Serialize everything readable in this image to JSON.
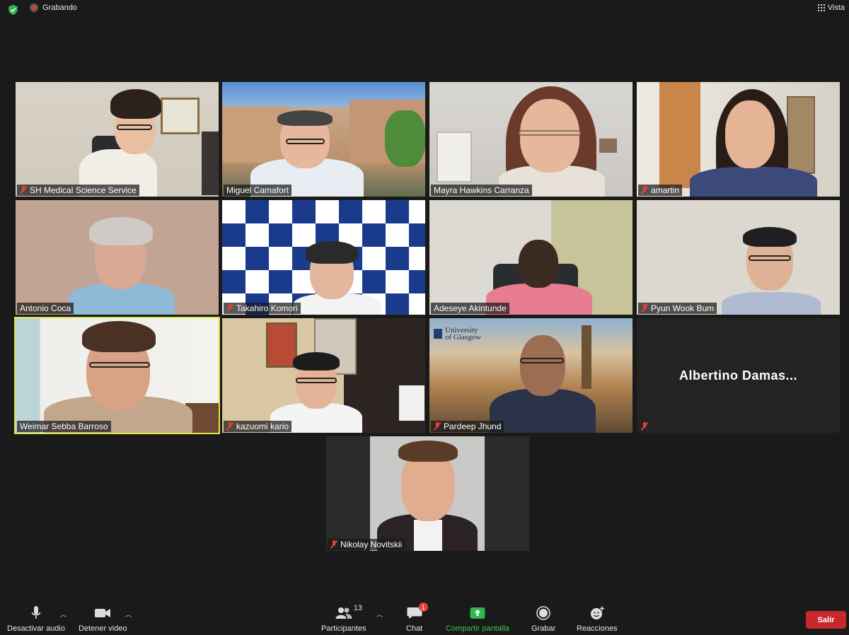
{
  "topbar": {
    "recording_label": "Grabando",
    "view_label": "Vista",
    "icons": [
      "shield-check-icon",
      "record-icon",
      "grid-view-icon"
    ]
  },
  "participants": [
    {
      "name": "SH Medical Science Service",
      "muted": true
    },
    {
      "name": "Miguel Camafort",
      "muted": false
    },
    {
      "name": "Mayra Hawkins Carranza",
      "muted": false
    },
    {
      "name": "amartin",
      "muted": true
    },
    {
      "name": "Antonio Coca",
      "muted": false
    },
    {
      "name": "Takahiro Komori",
      "muted": true
    },
    {
      "name": "Adeseye Akintunde",
      "muted": false
    },
    {
      "name": "Pyun Wook Bum",
      "muted": true
    },
    {
      "name": "Weimar Sebba Barroso",
      "muted": false,
      "active_speaker": true
    },
    {
      "name": "kazuomi kario",
      "muted": true
    },
    {
      "name": "Pardeep Jhund",
      "muted": true
    },
    {
      "name": "Albertino Damas...",
      "muted": true,
      "video_off": true
    },
    {
      "name": "Nikolay Novitskii",
      "muted": true
    }
  ],
  "backgrounds": {
    "university_logo_line1": "University",
    "university_logo_line2": "of Glasgow"
  },
  "toolbar": {
    "mute_label": "Desactivar audio",
    "video_label": "Detener video",
    "participants_label": "Participantes",
    "participants_count": "13",
    "chat_label": "Chat",
    "chat_badge": "1",
    "share_label": "Compartir pantalla",
    "record_label": "Grabar",
    "reactions_label": "Reacciones",
    "leave_label": "Salir"
  },
  "colors": {
    "background": "#1a1a1a",
    "active_speaker": "#d9e64a",
    "muted": "#e0413a",
    "share_green": "#42c542",
    "leave_red": "#c8282c"
  }
}
